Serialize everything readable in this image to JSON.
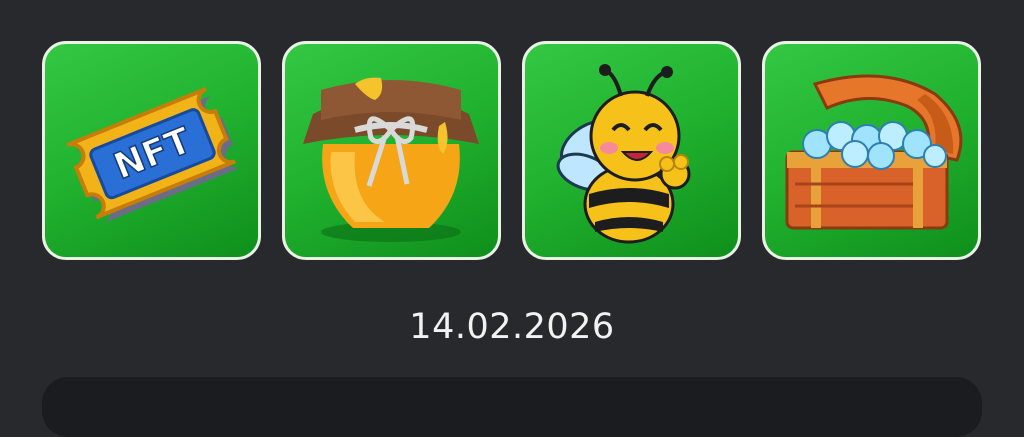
{
  "tiles": [
    {
      "id": "nft",
      "icon": "nft-ticket-icon",
      "text": "NFT"
    },
    {
      "id": "honey",
      "icon": "honey-jar-icon"
    },
    {
      "id": "bee",
      "icon": "bee-icon"
    },
    {
      "id": "chest",
      "icon": "treasure-chest-icon"
    }
  ],
  "date": "14.02.2026",
  "colors": {
    "background": "#28292d",
    "tile_green": "#22b430",
    "tile_border": "#e9f3e6",
    "panel": "#1b1c1f",
    "date_text": "#f2f2f2"
  }
}
